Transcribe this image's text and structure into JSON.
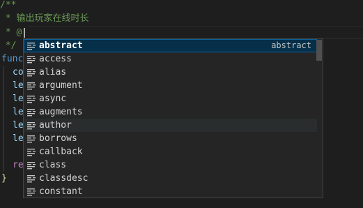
{
  "editor": {
    "comment_open": "/**",
    "comment_line1": " * 输出玩家在线时长",
    "comment_line2": " * @",
    "comment_close": " */",
    "code_fragments": [
      "func",
      "co",
      "le",
      "le",
      "le",
      "le",
      "le",
      "re",
      "}"
    ]
  },
  "suggest": {
    "items": [
      {
        "label": "abstract",
        "detail": "abstract",
        "icon": "snippet-icon"
      },
      {
        "label": "access",
        "icon": "snippet-icon"
      },
      {
        "label": "alias",
        "icon": "snippet-icon"
      },
      {
        "label": "argument",
        "icon": "snippet-icon"
      },
      {
        "label": "async",
        "icon": "snippet-icon"
      },
      {
        "label": "augments",
        "icon": "snippet-icon"
      },
      {
        "label": "author",
        "icon": "snippet-icon"
      },
      {
        "label": "borrows",
        "icon": "snippet-icon"
      },
      {
        "label": "callback",
        "icon": "snippet-icon"
      },
      {
        "label": "class",
        "icon": "snippet-icon"
      },
      {
        "label": "classdesc",
        "icon": "snippet-icon"
      },
      {
        "label": "constant",
        "icon": "snippet-icon"
      }
    ]
  },
  "colors": {
    "comment": "#6a9955",
    "selection_bg": "#062f4a",
    "match": "#18a3ff",
    "widget_bg": "#252526"
  }
}
